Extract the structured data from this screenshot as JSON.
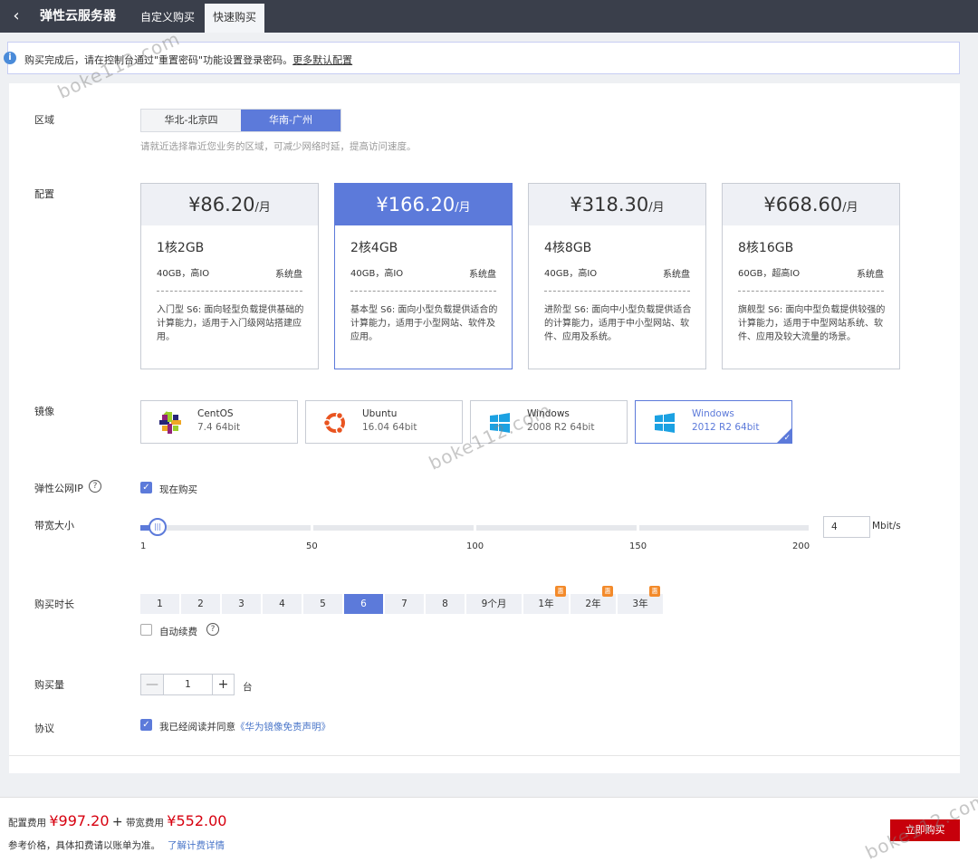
{
  "topbar": {
    "back_icon": "‹",
    "title": "弹性云服务器",
    "tabs": [
      "自定义购买",
      "快速购买"
    ]
  },
  "notice": {
    "text": "购买完成后，请在控制台通过\"重置密码\"功能设置登录密码。",
    "link": "更多默认配置"
  },
  "region": {
    "label": "区域",
    "options": [
      "华北-北京四",
      "华南-广州"
    ],
    "selected": "华南-广州",
    "hint": "请就近选择靠近您业务的区域，可减少网络时延，提高访问速度。"
  },
  "config": {
    "label": "配置",
    "cards": [
      {
        "price": "¥86.20",
        "unit": "/月",
        "spec": "1核2GB",
        "disk": "40GB，高IO",
        "sys": "系统盘",
        "desc": "入门型 S6: 面向轻型负载提供基础的计算能力，适用于入门级网站搭建应用。"
      },
      {
        "price": "¥166.20",
        "unit": "/月",
        "spec": "2核4GB",
        "disk": "40GB，高IO",
        "sys": "系统盘",
        "desc": "基本型 S6: 面向小型负载提供适合的计算能力，适用于小型网站、软件及应用。"
      },
      {
        "price": "¥318.30",
        "unit": "/月",
        "spec": "4核8GB",
        "disk": "40GB，高IO",
        "sys": "系统盘",
        "desc": "进阶型 S6: 面向中小型负载提供适合的计算能力，适用于中小型网站、软件、应用及系统。"
      },
      {
        "price": "¥668.60",
        "unit": "/月",
        "spec": "8核16GB",
        "disk": "60GB，超高IO",
        "sys": "系统盘",
        "desc": "旗舰型 S6: 面向中型负载提供较强的计算能力，适用于中型网站系统、软件、应用及较大流量的场景。"
      }
    ]
  },
  "image": {
    "label": "镜像",
    "options": [
      {
        "name": "CentOS",
        "version": "7.4 64bit"
      },
      {
        "name": "Ubuntu",
        "version": "16.04 64bit"
      },
      {
        "name": "Windows",
        "version": "2008 R2 64bit"
      },
      {
        "name": "Windows",
        "version": "2012 R2 64bit"
      }
    ]
  },
  "eip": {
    "label": "弹性公网IP",
    "checkbox_label": "现在购买",
    "checked": true
  },
  "bandwidth": {
    "label": "带宽大小",
    "ticks": [
      "1",
      "50",
      "100",
      "150",
      "200"
    ],
    "value": "4",
    "unit": "Mbit/s"
  },
  "duration": {
    "label": "购买时长",
    "options": [
      "1",
      "2",
      "3",
      "4",
      "5",
      "6",
      "7",
      "8",
      "9个月",
      "1年",
      "2年",
      "3年"
    ],
    "selected": "6",
    "auto_renew_label": "自动续费"
  },
  "quantity": {
    "label": "购买量",
    "minus": "—",
    "value": "1",
    "plus": "+",
    "unit": "台"
  },
  "agreement": {
    "label": "协议",
    "text": "我已经阅读并同意",
    "link": "《华为镜像免责声明》"
  },
  "footer": {
    "config_fee_label": "配置费用",
    "config_fee": "¥997.20",
    "plus": "+",
    "bw_fee_label": "带宽费用",
    "bw_fee": "¥552.00",
    "note": "参考价格，具体扣费请以账单为准。",
    "detail_link": "了解计费详情",
    "buy_label": "立即购买"
  },
  "watermark": "boke112.com",
  "colors": {
    "accent": "#5c7ada",
    "buy": "#c7000b",
    "price": "#d7000f",
    "badge": "#f38a2a"
  }
}
